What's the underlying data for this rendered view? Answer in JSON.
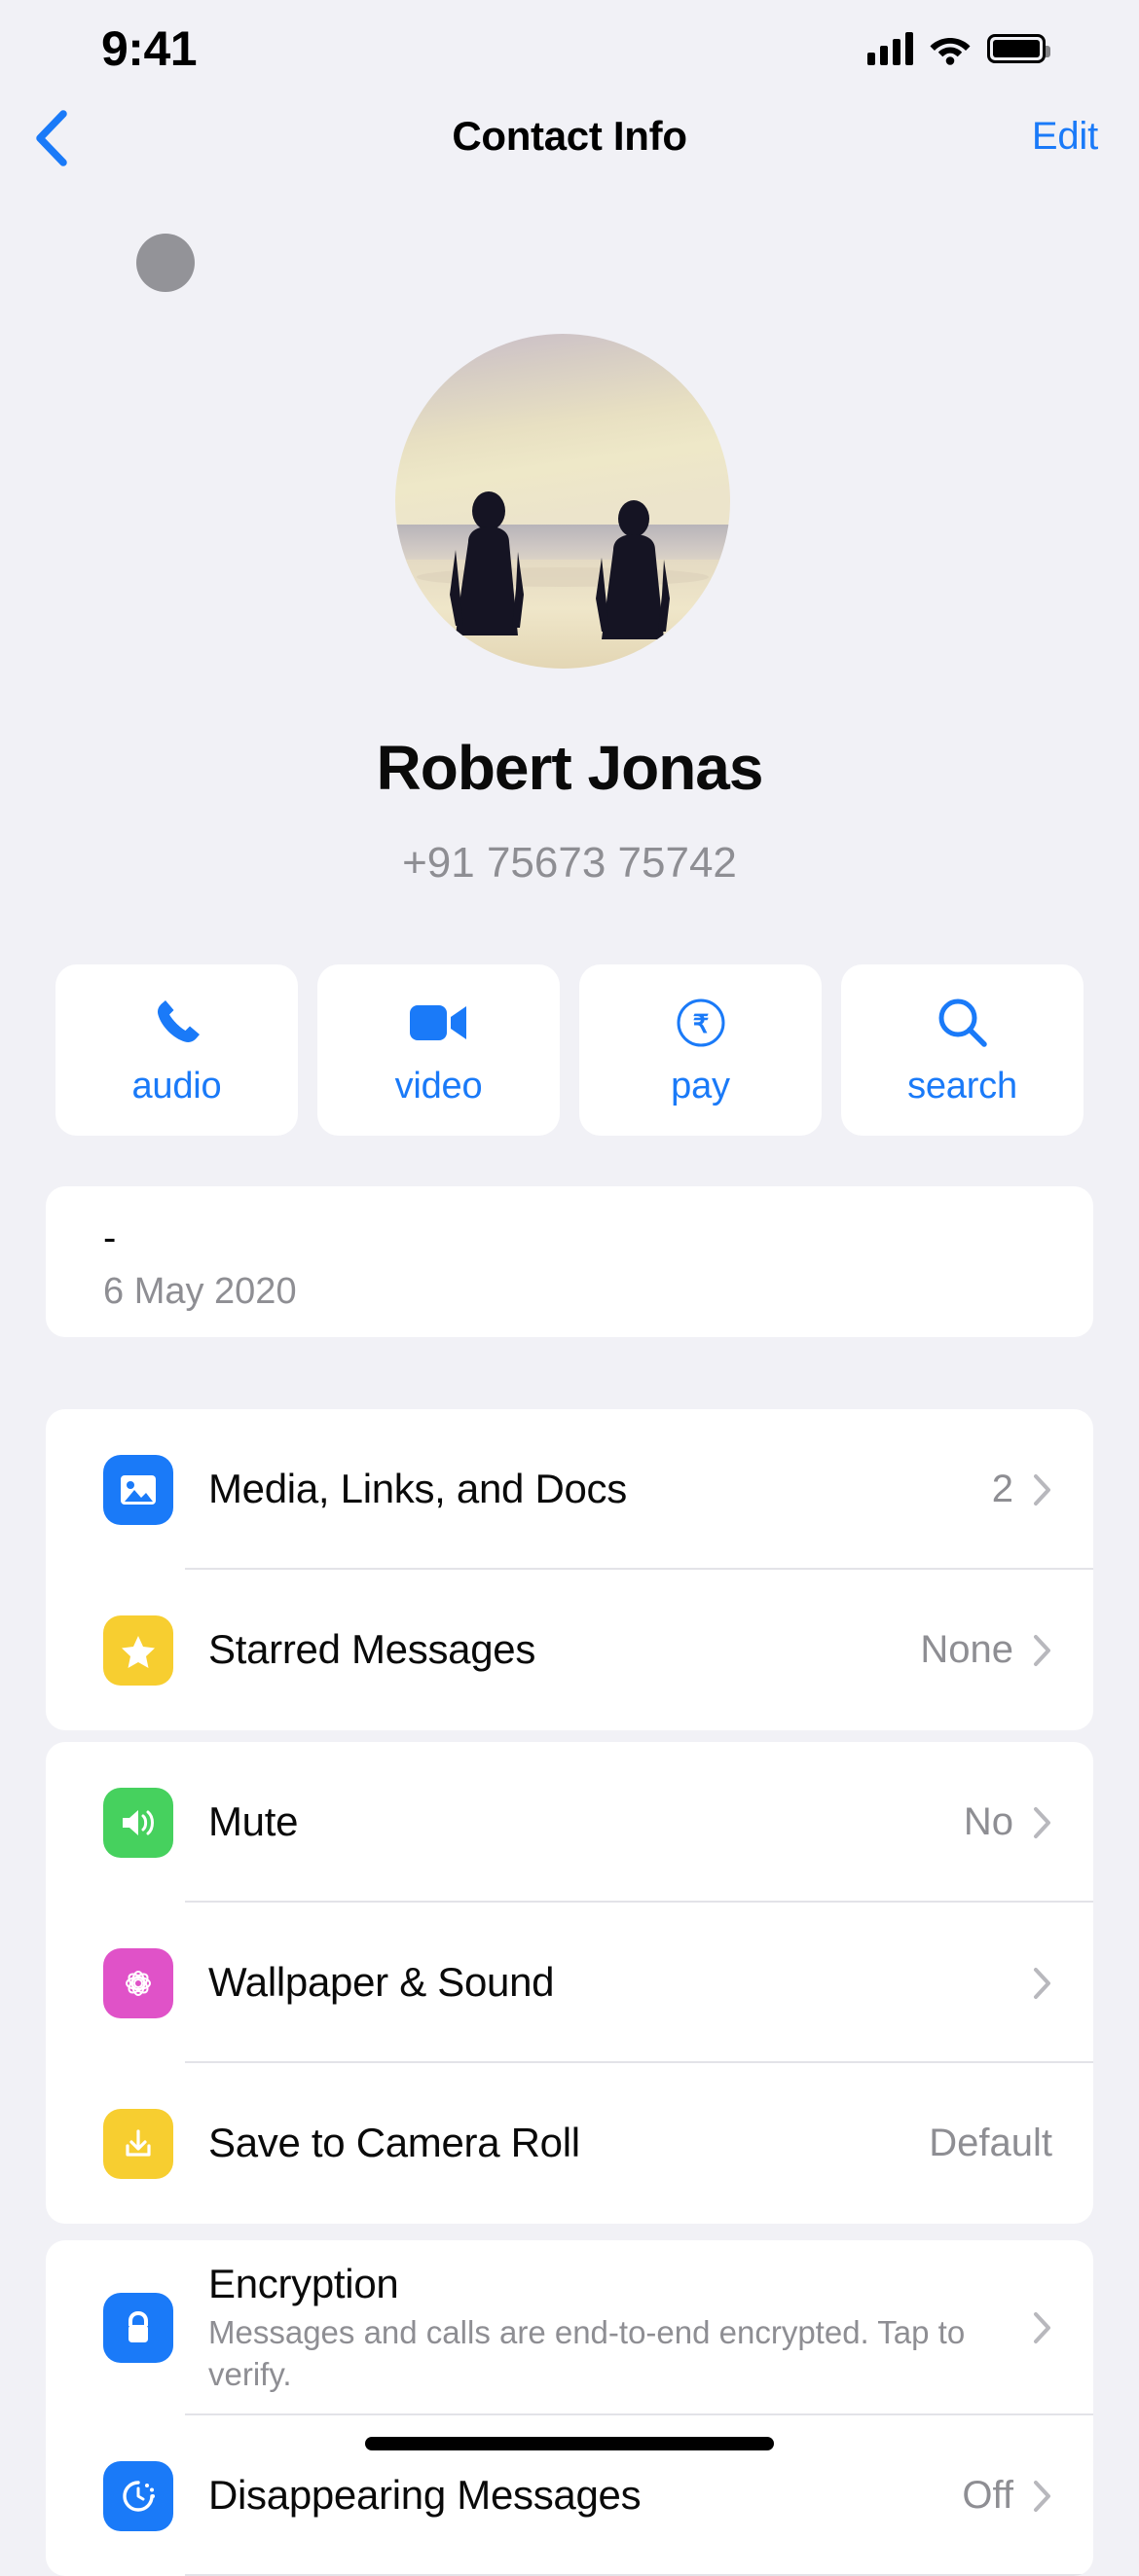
{
  "status_bar": {
    "time": "9:41",
    "signal_icon": "cellular-bars-icon",
    "wifi_icon": "wifi-icon",
    "battery_icon": "battery-full-icon"
  },
  "nav": {
    "back_icon": "chevron-left-icon",
    "title": "Contact Info",
    "edit_label": "Edit"
  },
  "profile": {
    "avatar_icon": "contact-avatar-photo",
    "mini_avatar_icon": "mini-avatar-circle",
    "name": "Robert Jonas",
    "phone": "+91 75673 75742"
  },
  "actions": [
    {
      "label": "audio",
      "icon": "phone-icon"
    },
    {
      "label": "video",
      "icon": "video-camera-icon"
    },
    {
      "label": "pay",
      "icon": "rupee-circle-icon"
    },
    {
      "label": "search",
      "icon": "search-icon"
    }
  ],
  "about": {
    "status": "-",
    "date": "6 May 2020"
  },
  "sections": [
    {
      "name": "media-section",
      "rows": [
        {
          "title": "Media, Links, and Docs",
          "value": "2",
          "icon": "photo-icon",
          "icon_color": "#1a7af8",
          "chevron": true
        },
        {
          "title": "Starred Messages",
          "value": "None",
          "icon": "star-icon",
          "icon_color": "#f7ce30",
          "chevron": true
        }
      ]
    },
    {
      "name": "chat-settings-section",
      "rows": [
        {
          "title": "Mute",
          "value": "No",
          "icon": "speaker-icon",
          "icon_color": "#46d15e",
          "chevron": true
        },
        {
          "title": "Wallpaper & Sound",
          "value": "",
          "icon": "flower-icon",
          "icon_color": "#e052c8",
          "chevron": true
        },
        {
          "title": "Save to Camera Roll",
          "value": "Default",
          "icon": "download-icon",
          "icon_color": "#f7ce30",
          "chevron": false
        }
      ]
    },
    {
      "name": "privacy-section",
      "rows": [
        {
          "title": "Encryption",
          "subtitle": "Messages and calls are end-to-end encrypted. Tap to verify.",
          "value": "",
          "icon": "lock-icon",
          "icon_color": "#1a7af8",
          "chevron": true
        },
        {
          "title": "Disappearing Messages",
          "value": "Off",
          "icon": "timer-icon",
          "icon_color": "#1a7af8",
          "chevron": true
        }
      ]
    }
  ],
  "colors": {
    "accent": "#1a7af8",
    "background": "#f1f1f6",
    "card": "#ffffff",
    "secondary_text": "#8e8e93"
  },
  "home_indicator": "home-indicator-bar"
}
